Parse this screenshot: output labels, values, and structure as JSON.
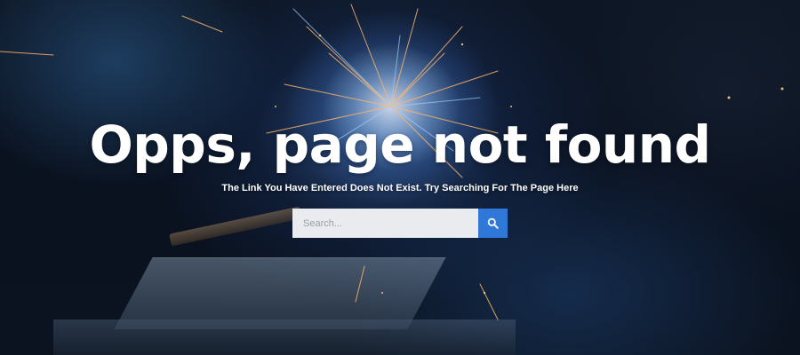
{
  "hero": {
    "title": "Opps, page not found",
    "subtitle": "The Link You Have Entered Does Not Exist. Try Searching For The Page Here"
  },
  "search": {
    "placeholder": "Search...",
    "value": "",
    "button_icon": "search-icon"
  },
  "colors": {
    "accent": "#2f78d8",
    "input_background": "#e9ebee",
    "title_text": "#ffffff"
  }
}
